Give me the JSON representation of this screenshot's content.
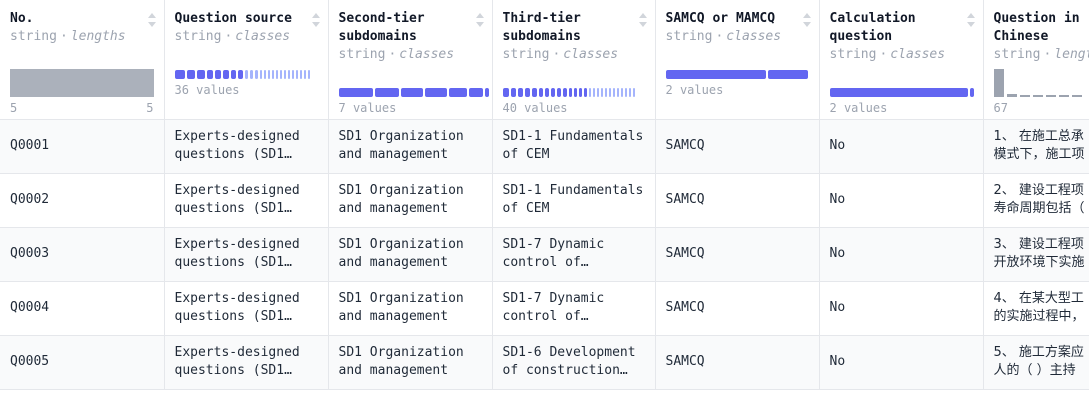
{
  "columns": [
    {
      "title": "No.",
      "type": "string",
      "kind": "lengths",
      "stat_min": "5",
      "stat_max": "5"
    },
    {
      "title": "Question source",
      "type": "string",
      "kind": "classes",
      "stat": "36 values"
    },
    {
      "title": "Second-tier subdomains",
      "type": "string",
      "kind": "classes",
      "stat": "7 values"
    },
    {
      "title": "Third-tier subdomains",
      "type": "string",
      "kind": "classes",
      "stat": "40 values"
    },
    {
      "title": "SAMCQ or MAMCQ",
      "type": "string",
      "kind": "classes",
      "stat": "2 values"
    },
    {
      "title": "Calculation question",
      "type": "string",
      "kind": "classes",
      "stat": "2 values"
    },
    {
      "title": "Question in Chinese",
      "type": "string",
      "kind": "lengths",
      "stat": "67"
    }
  ],
  "rows": [
    {
      "no": "Q0001",
      "source": "Experts-designed questions (SD1…",
      "second": "SD1 Organization and management",
      "third": "SD1-1 Fundamentals of CEM",
      "samcq": "SAMCQ",
      "calc": "No",
      "zh_line1": "1、 在施工总承",
      "zh_line2": "模式下，施工项"
    },
    {
      "no": "Q0002",
      "source": "Experts-designed questions (SD1…",
      "second": "SD1 Organization and management",
      "third": "SD1-1 Fundamentals of CEM",
      "samcq": "SAMCQ",
      "calc": "No",
      "zh_line1": "2、 建设工程项",
      "zh_line2": "寿命周期包括（"
    },
    {
      "no": "Q0003",
      "source": "Experts-designed questions (SD1…",
      "second": "SD1 Organization and management",
      "third": "SD1-7 Dynamic control of…",
      "samcq": "SAMCQ",
      "calc": "No",
      "zh_line1": "3、 建设工程项",
      "zh_line2": "开放环境下实施"
    },
    {
      "no": "Q0004",
      "source": "Experts-designed questions (SD1…",
      "second": "SD1 Organization and management",
      "third": "SD1-7 Dynamic control of…",
      "samcq": "SAMCQ",
      "calc": "No",
      "zh_line1": "4、 在某大型工",
      "zh_line2": "的实施过程中，"
    },
    {
      "no": "Q0005",
      "source": "Experts-designed questions (SD1…",
      "second": "SD1 Organization and management",
      "third": "SD1-6 Development of construction…",
      "samcq": "SAMCQ",
      "calc": "No",
      "zh_line1": "5、 施工方案应",
      "zh_line2": "人的（ ）主持"
    }
  ],
  "colors": {
    "accent": "#6366f1",
    "muted": "#9ca3af",
    "border": "#e5e7eb"
  },
  "icons": {
    "sort": "sort-updown-icon"
  }
}
